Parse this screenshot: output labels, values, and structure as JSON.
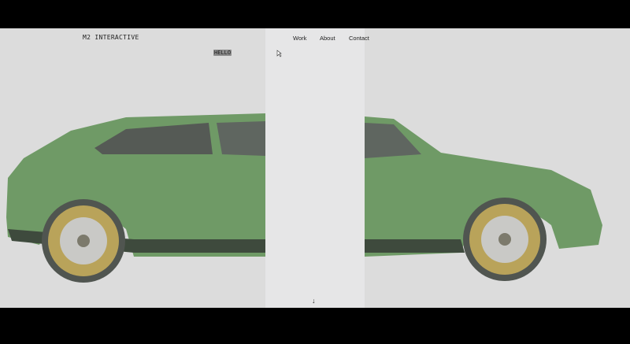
{
  "header": {
    "logo": "M2 INTERACTIVE",
    "hello_badge": "HELLO"
  },
  "nav": [
    {
      "label": "Work"
    },
    {
      "label": "About"
    },
    {
      "label": "Contact"
    }
  ],
  "scroll_indicator": "↓",
  "colors": {
    "background": "#dcdcdc",
    "panel": "#e6e6e7",
    "car_body": "#6f9a66",
    "wheel": "#b9a35a"
  }
}
